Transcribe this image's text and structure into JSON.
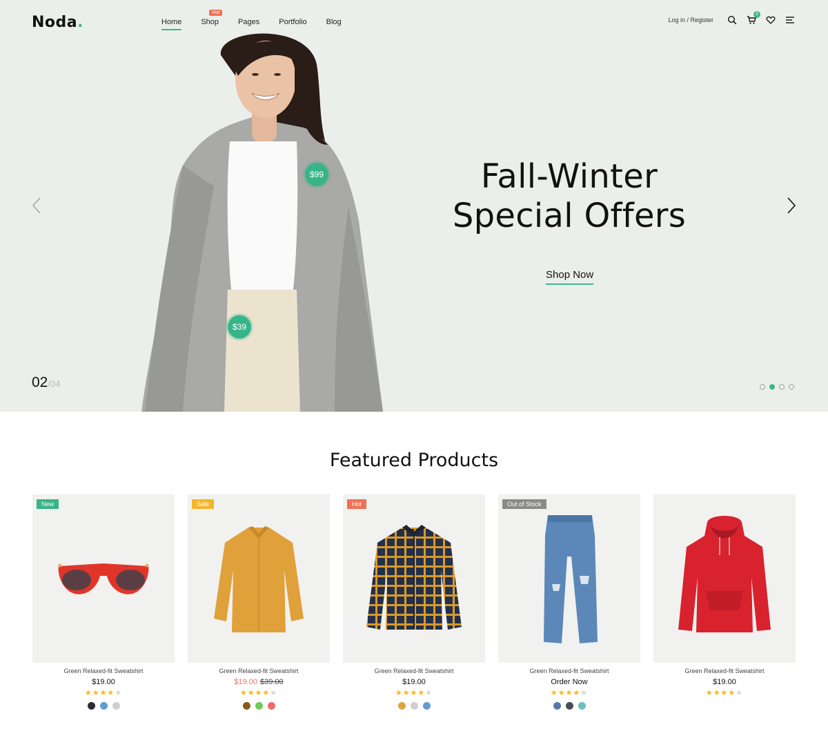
{
  "header": {
    "logo": "Noda",
    "logo_dot": ".",
    "nav": [
      {
        "label": "Home",
        "active": true
      },
      {
        "label": "Shop",
        "badge": "Hot"
      },
      {
        "label": "Pages"
      },
      {
        "label": "Portfolio"
      },
      {
        "label": "Blog"
      }
    ],
    "login": "Log in / Register",
    "cart_count": "2",
    "icons": [
      "search-icon",
      "cart-icon",
      "heart-icon",
      "menu-icon"
    ]
  },
  "hero": {
    "title_line1": "Fall-Winter",
    "title_line2": "Special Offers",
    "cta": "Shop Now",
    "price_tag_1": "$99",
    "price_tag_2": "$39",
    "slide_current": "02",
    "slide_total": "/04",
    "dots": [
      false,
      true,
      false,
      false
    ],
    "accent": "#3bb78f"
  },
  "featured": {
    "title": "Featured Products",
    "products": [
      {
        "badge": "New",
        "badge_color": "#37b48a",
        "name": "Green Relaxed-fit Sweatshirt",
        "price": "$19.00",
        "rating": 4,
        "swatches": [
          "#2b2d35",
          "#5f9cd1",
          "#cfcfcf"
        ],
        "image": "sunglasses"
      },
      {
        "badge": "Sale",
        "badge_color": "#f3b62b",
        "name": "Green Relaxed-fit Sweatshirt",
        "sale_price": "$19.00",
        "old_price": "$39.00",
        "rating": 4,
        "swatches": [
          "#8a5a17",
          "#6ccb5a",
          "#f06a6a"
        ],
        "image": "blouse"
      },
      {
        "badge": "Hot",
        "badge_color": "#f07156",
        "name": "Green Relaxed-fit Sweatshirt",
        "price": "$19.00",
        "rating": 4,
        "swatches": [
          "#e0a447",
          "#cfcfcf",
          "#5f9cd1"
        ],
        "image": "plaid-shirt"
      },
      {
        "badge": "Out of Stock",
        "badge_color": "#8a8a8a",
        "name": "Green Relaxed-fit Sweatshirt",
        "price": "Order Now",
        "rating": 4,
        "swatches": [
          "#5878a6",
          "#4a4d55",
          "#6cc0c0"
        ],
        "image": "jeans"
      },
      {
        "name": "Green Relaxed-fit Sweatshirt",
        "price": "$19.00",
        "rating": 4,
        "swatches": [],
        "image": "hoodie"
      }
    ]
  }
}
